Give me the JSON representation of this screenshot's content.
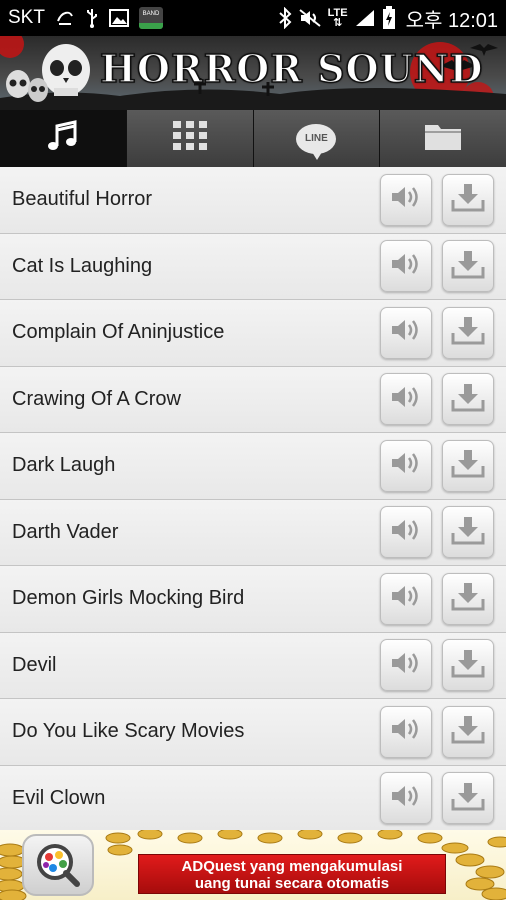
{
  "status_bar": {
    "carrier": "SKT",
    "network": "LTE",
    "time": "오후 12:01",
    "band_label": "BAND",
    "icons": [
      "carrier-logo-icon",
      "usb-icon",
      "image-icon",
      "band-app-icon",
      "bluetooth-icon",
      "mute-icon",
      "lte-icon",
      "signal-icon",
      "battery-icon"
    ]
  },
  "banner": {
    "title": "HORROR SOUND"
  },
  "tabs": [
    {
      "name": "music",
      "icon": "music-note-icon",
      "active": true
    },
    {
      "name": "grid",
      "icon": "grid-icon",
      "active": false
    },
    {
      "name": "line",
      "icon": "line-icon",
      "label": "LINE",
      "active": false
    },
    {
      "name": "folder",
      "icon": "folder-icon",
      "active": false
    }
  ],
  "sounds": [
    {
      "title": "Beautiful Horror"
    },
    {
      "title": "Cat Is Laughing"
    },
    {
      "title": "Complain Of Aninjustice"
    },
    {
      "title": "Crawing Of A Crow"
    },
    {
      "title": "Dark Laugh"
    },
    {
      "title": "Darth Vader"
    },
    {
      "title": "Demon Girls Mocking Bird"
    },
    {
      "title": "Devil"
    },
    {
      "title": "Do You Like Scary Movies"
    },
    {
      "title": "Evil Clown"
    }
  ],
  "ad": {
    "line1": "ADQuest yang mengakumulasi",
    "line2": "uang tunai secara otomatis"
  },
  "colors": {
    "accent_red": "#c41414",
    "tab_dark": "#0f0f0f",
    "row_bg": "#ededed"
  }
}
